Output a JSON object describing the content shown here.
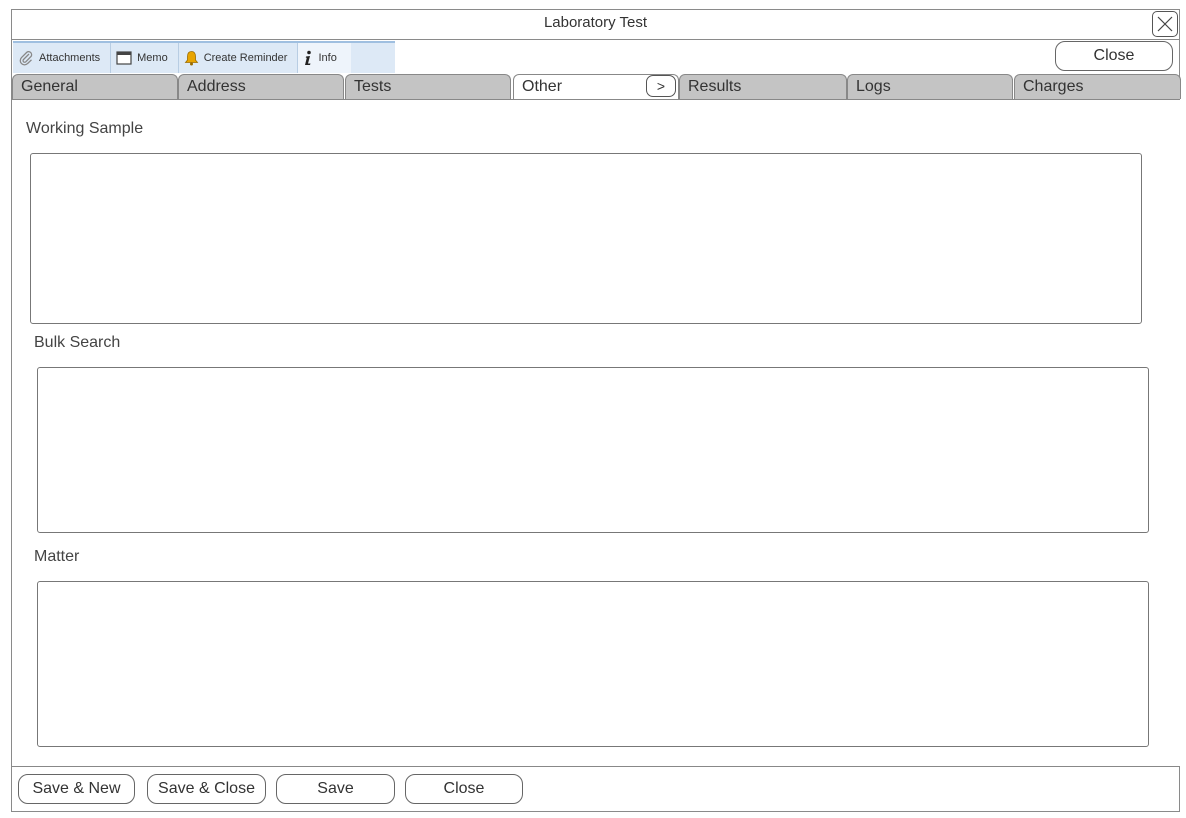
{
  "window": {
    "title": "Laboratory Test"
  },
  "toolbar": {
    "items": [
      {
        "label": "Attachments",
        "icon": "paperclip-icon"
      },
      {
        "label": "Memo",
        "icon": "memo-window-icon"
      },
      {
        "label": "Create Reminder",
        "icon": "bell-icon"
      },
      {
        "label": "Info",
        "icon": "info-icon"
      }
    ],
    "close_label": "Close"
  },
  "tabs": [
    {
      "label": "General"
    },
    {
      "label": "Address"
    },
    {
      "label": "Tests"
    },
    {
      "label": "Other",
      "active": true
    },
    {
      "label": "Results"
    },
    {
      "label": "Logs"
    },
    {
      "label": "Charges"
    }
  ],
  "tab_scroll_label": ">",
  "form": {
    "working_sample": {
      "label": "Working Sample",
      "value": ""
    },
    "bulk_search": {
      "label": "Bulk Search",
      "value": ""
    },
    "matter": {
      "label": "Matter",
      "value": ""
    }
  },
  "footer": {
    "save_new": "Save & New",
    "save_close": "Save & Close",
    "save": "Save",
    "close": "Close"
  },
  "colors": {
    "toolbar_bg": "#dde9f6",
    "tab_inactive": "#c4c4c4",
    "tab_active": "#ffffff",
    "bell": "#e8a400"
  }
}
